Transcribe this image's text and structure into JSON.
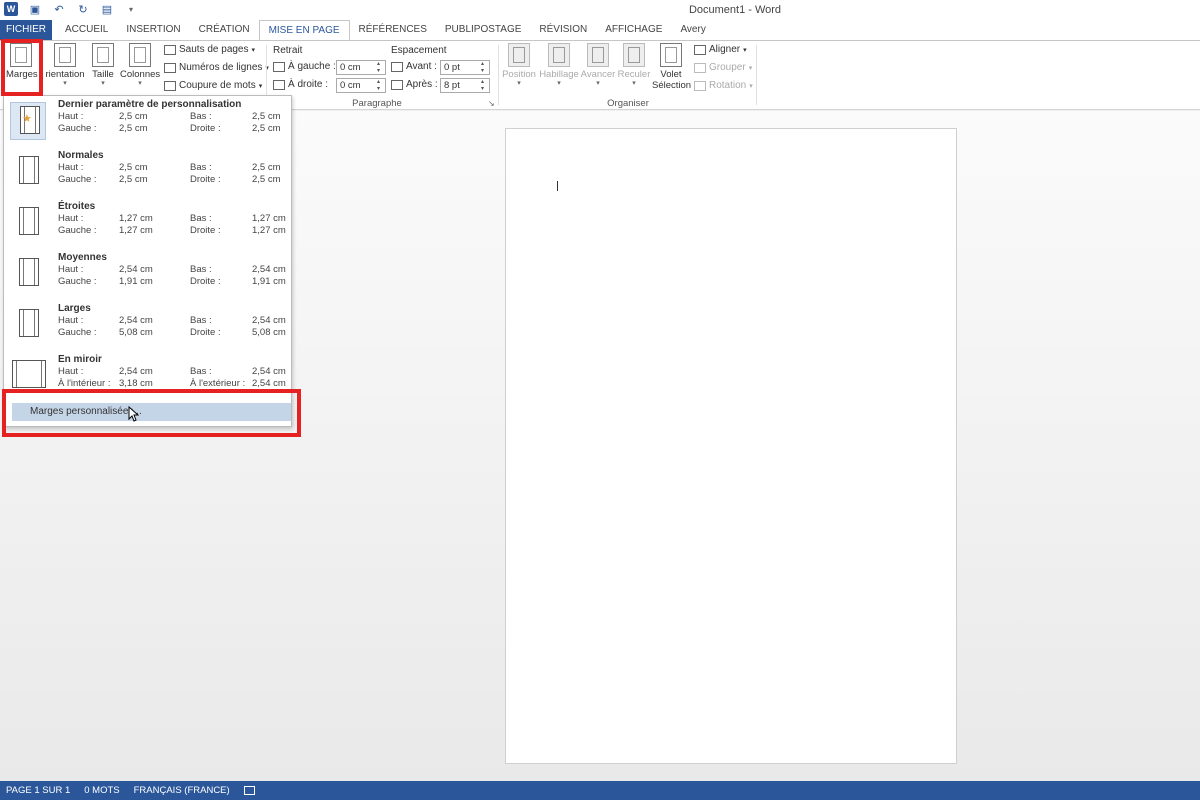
{
  "window": {
    "title": "Document1 - Word"
  },
  "tabs": [
    "FICHIER",
    "ACCUEIL",
    "INSERTION",
    "CRÉATION",
    "MISE EN PAGE",
    "RÉFÉRENCES",
    "PUBLIPOSTAGE",
    "RÉVISION",
    "AFFICHAGE",
    "Avery"
  ],
  "active_tab": "MISE EN PAGE",
  "ribbon": {
    "mise_en_page": {
      "marges": "Marges",
      "orientation": "rientation",
      "taille": "Taille",
      "colonnes": "Colonnes",
      "sauts": "Sauts de pages",
      "numeros": "Numéros de lignes",
      "coupure": "Coupure de mots"
    },
    "paragraphe": {
      "label": "Paragraphe",
      "retrait": "Retrait",
      "espacement": "Espacement",
      "a_gauche": "À gauche :",
      "a_droite": "À droite :",
      "avant": "Avant :",
      "apres": "Après :",
      "gauche_val": "0 cm",
      "droite_val": "0 cm",
      "avant_val": "0  pt",
      "apres_val": "8  pt"
    },
    "organiser": {
      "label": "Organiser",
      "position": "Position",
      "habillage": "Habillage",
      "avancer": "Avancer",
      "reculer": "Reculer",
      "volet": "Volet",
      "selection": "Sélection",
      "aligner": "Aligner",
      "grouper": "Grouper",
      "rotation": "Rotation"
    }
  },
  "margins_menu": {
    "options": [
      {
        "name": "Dernier paramètre de personnalisation",
        "k1": "Haut :",
        "v1": "2,5 cm",
        "k2": "Bas :",
        "v2": "2,5 cm",
        "k3": "Gauche :",
        "v3": "2,5 cm",
        "k4": "Droite :",
        "v4": "2,5 cm"
      },
      {
        "name": "Normales",
        "k1": "Haut :",
        "v1": "2,5 cm",
        "k2": "Bas :",
        "v2": "2,5 cm",
        "k3": "Gauche :",
        "v3": "2,5 cm",
        "k4": "Droite :",
        "v4": "2,5 cm"
      },
      {
        "name": "Étroites",
        "k1": "Haut :",
        "v1": "1,27 cm",
        "k2": "Bas :",
        "v2": "1,27 cm",
        "k3": "Gauche :",
        "v3": "1,27 cm",
        "k4": "Droite :",
        "v4": "1,27 cm"
      },
      {
        "name": "Moyennes",
        "k1": "Haut :",
        "v1": "2,54 cm",
        "k2": "Bas :",
        "v2": "2,54 cm",
        "k3": "Gauche :",
        "v3": "1,91 cm",
        "k4": "Droite :",
        "v4": "1,91 cm"
      },
      {
        "name": "Larges",
        "k1": "Haut :",
        "v1": "2,54 cm",
        "k2": "Bas :",
        "v2": "2,54 cm",
        "k3": "Gauche :",
        "v3": "5,08 cm",
        "k4": "Droite :",
        "v4": "5,08 cm"
      },
      {
        "name": "En miroir",
        "k1": "Haut :",
        "v1": "2,54 cm",
        "k2": "Bas :",
        "v2": "2,54 cm",
        "k3": "À l'intérieur :",
        "v3": "3,18 cm",
        "k4": "À l'extérieur :",
        "v4": "2,54 cm"
      }
    ],
    "custom": "Marges personnalisées..."
  },
  "status": {
    "page": "PAGE 1 SUR 1",
    "words": "0 MOTS",
    "language": "FRANÇAIS (FRANCE)"
  },
  "colors": {
    "accent": "#2b579a",
    "highlight": "#e62121",
    "menu_hover": "#c5d5e8"
  }
}
